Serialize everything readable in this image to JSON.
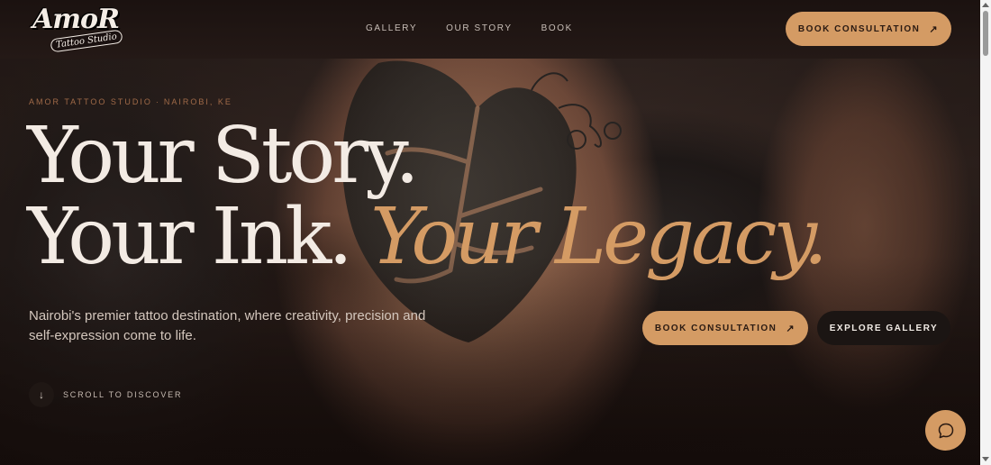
{
  "brand": {
    "logo_text": "AmoR",
    "logo_sub": "Tattoo Studio"
  },
  "nav": {
    "items": [
      {
        "label": "GALLERY"
      },
      {
        "label": "OUR STORY"
      },
      {
        "label": "BOOK"
      }
    ],
    "cta_label": "BOOK CONSULTATION"
  },
  "hero": {
    "eyebrow_left": "AMOR TATTOO STUDIO",
    "eyebrow_right": "NAIROBI, KE",
    "headline_line1": "Your Story.",
    "headline_line2_plain": "Your Ink.",
    "headline_line2_accent": "Your Legacy.",
    "subtext": "Nairobi's premier tattoo destination, where creativity, precision and self-expression come to life.",
    "primary_cta": "BOOK CONSULTATION",
    "secondary_cta": "EXPLORE GALLERY",
    "scroll_label": "SCROLL TO DISCOVER"
  },
  "icons": {
    "cta_arrow": "arrow-up-right-icon",
    "scroll": "arrow-down-icon",
    "chat": "chat-bubble-icon"
  },
  "colors": {
    "accent": "#d49b64",
    "text_light": "#f3ebe4",
    "header_bg": "#1b1210",
    "button_dark": "#1b1513"
  }
}
